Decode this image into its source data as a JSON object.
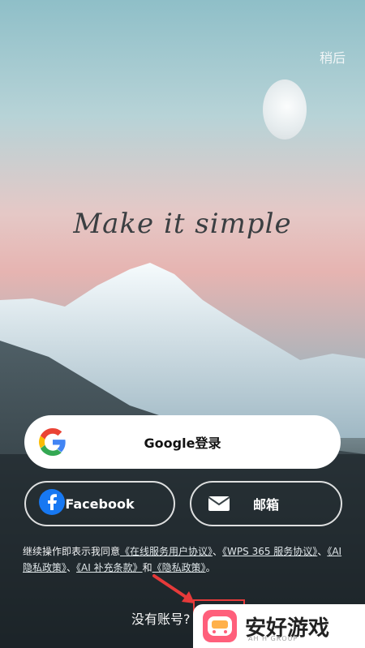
{
  "header": {
    "later_label": "稍后"
  },
  "hero": {
    "headline": "Make it simple"
  },
  "buttons": {
    "google": {
      "label": "Google登录",
      "icon": "google-icon"
    },
    "facebook": {
      "label": "Facebook",
      "icon": "facebook-icon"
    },
    "email": {
      "label": "邮箱",
      "icon": "mail-icon"
    }
  },
  "terms": {
    "prefix": "继续操作即表示我同意",
    "link1": "《在线服务用户协议》",
    "sep1": "、",
    "link2": "《WPS 365 服务协议》",
    "sep2": "、",
    "link3": "《AI 隐私政策》",
    "sep3": "、",
    "link4": "《AI 补充条款》",
    "and": "和",
    "link5": "《隐私政策》",
    "suffix": "。"
  },
  "footer": {
    "no_account": "没有账号?"
  },
  "watermark": {
    "title": "安好游戏",
    "subtitle": "AH H GROUP"
  },
  "colors": {
    "facebook_blue": "#1778f2",
    "annotation_red": "#e63a3a"
  }
}
